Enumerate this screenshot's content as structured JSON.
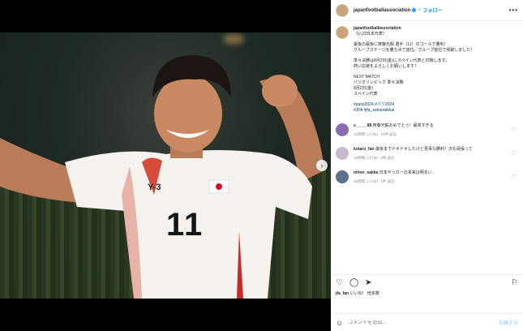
{
  "post": {
    "username": "japanfootballassociation",
    "follow_label": "フォロー",
    "separator": "•",
    "more_label": "•••",
    "next_label": "›"
  },
  "caption": {
    "username": "japanfootballassociation",
    "lines": [
      "〈U-23日本代表〉",
      "",
      "最後の最後に斉藤光毅 選手（11）のゴールで勝利！",
      "グループステージを勝ち点で首位、グループ首位で突破しました！",
      "",
      "準々決勝は8月2日(金)にスペイン代表と対戦します。",
      "熱い応援をよろしくお願いします！",
      "",
      "NEXT MATCH",
      "パリオリンピック 準々決勝",
      "8月2日(金)",
      "スペイン代表",
      "",
      "#paris2024 #パリ2024",
      "#JFA #jfa_samuraiblue"
    ]
  },
  "comments": [
    {
      "user": "s_____88",
      "text": "斉藤光毅おめでとう！最高すぎる",
      "meta": "15時間  いいね！12件  返信",
      "color": "#8b6bb5"
    },
    {
      "user": "kotaro_fan",
      "text": "最後までドキドキしたけど見事な勝利！次も頑張って",
      "meta": "15時間  いいね！3件  返信",
      "color": "#c9b9cf"
    },
    {
      "user": "nihon_sakka",
      "text": "日本サッカーの未来は明るい",
      "meta": "15時間  いいね！1件  返信",
      "color": "#5b6f8f"
    }
  ],
  "actions": {
    "like_icon": "heart-icon",
    "comment_icon": "comment-icon",
    "share_icon": "share-icon",
    "save_icon": "bookmark-icon"
  },
  "likes_text": "いいね！ 他多数",
  "likes_user": "jfa_fan",
  "add_comment_placeholder": "コメントを追加...",
  "post_label": "投稿する",
  "emoji_label": "☺",
  "jersey_number": "11",
  "sponsor_mark": "Y-3"
}
